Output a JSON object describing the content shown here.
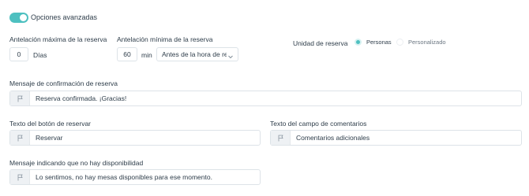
{
  "advanced": {
    "toggle_on": true,
    "label": "Opciones avanzadas"
  },
  "max_advance": {
    "label": "Antelación máxima de la reserva",
    "value": "0",
    "unit": "Días"
  },
  "min_advance": {
    "label": "Antelación mínima de la reserva",
    "value": "60",
    "unit": "min",
    "select_value": "Antes de la hora de reserva"
  },
  "booking_unit": {
    "label": "Unidad de reserva",
    "options": [
      {
        "label": "Personas",
        "selected": true
      },
      {
        "label": "Personalizado",
        "selected": false
      }
    ]
  },
  "confirmation": {
    "label": "Mensaje de confirmación de reserva",
    "value": "Reserva confirmada. ¡Gracias!"
  },
  "book_button_text": {
    "label": "Texto del botón de reservar",
    "value": "Reservar"
  },
  "comments_field_text": {
    "label": "Texto del campo de comentarios",
    "value": "Comentarios adicionales"
  },
  "no_availability": {
    "label": "Mensaje indicando que no hay disponibilidad",
    "value": "Lo sentimos, no hay mesas disponibles para ese momento."
  },
  "colors": {
    "accent": "#4ec0c0",
    "text": "#2e3d4a",
    "border": "#dde3e8",
    "flag_cell": "#eef1f4"
  },
  "icons": {
    "field_icon": "flag-icon",
    "select_icon": "chevron-down-icon"
  }
}
